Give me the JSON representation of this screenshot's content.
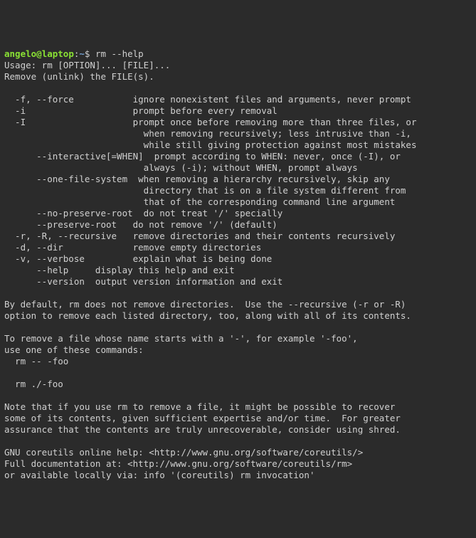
{
  "prompt": {
    "user": "angelo",
    "at": "@",
    "host": "laptop",
    "colon": ":",
    "path": "~",
    "symbol": "$ "
  },
  "command": "rm --help",
  "output": "Usage: rm [OPTION]... [FILE]...\nRemove (unlink) the FILE(s).\n\n  -f, --force           ignore nonexistent files and arguments, never prompt\n  -i                    prompt before every removal\n  -I                    prompt once before removing more than three files, or\n                          when removing recursively; less intrusive than -i,\n                          while still giving protection against most mistakes\n      --interactive[=WHEN]  prompt according to WHEN: never, once (-I), or\n                          always (-i); without WHEN, prompt always\n      --one-file-system  when removing a hierarchy recursively, skip any\n                          directory that is on a file system different from\n                          that of the corresponding command line argument\n      --no-preserve-root  do not treat '/' specially\n      --preserve-root   do not remove '/' (default)\n  -r, -R, --recursive   remove directories and their contents recursively\n  -d, --dir             remove empty directories\n  -v, --verbose         explain what is being done\n      --help     display this help and exit\n      --version  output version information and exit\n\nBy default, rm does not remove directories.  Use the --recursive (-r or -R)\noption to remove each listed directory, too, along with all of its contents.\n\nTo remove a file whose name starts with a '-', for example '-foo',\nuse one of these commands:\n  rm -- -foo\n\n  rm ./-foo\n\nNote that if you use rm to remove a file, it might be possible to recover\nsome of its contents, given sufficient expertise and/or time.  For greater\nassurance that the contents are truly unrecoverable, consider using shred.\n\nGNU coreutils online help: <http://www.gnu.org/software/coreutils/>\nFull documentation at: <http://www.gnu.org/software/coreutils/rm>\nor available locally via: info '(coreutils) rm invocation'"
}
